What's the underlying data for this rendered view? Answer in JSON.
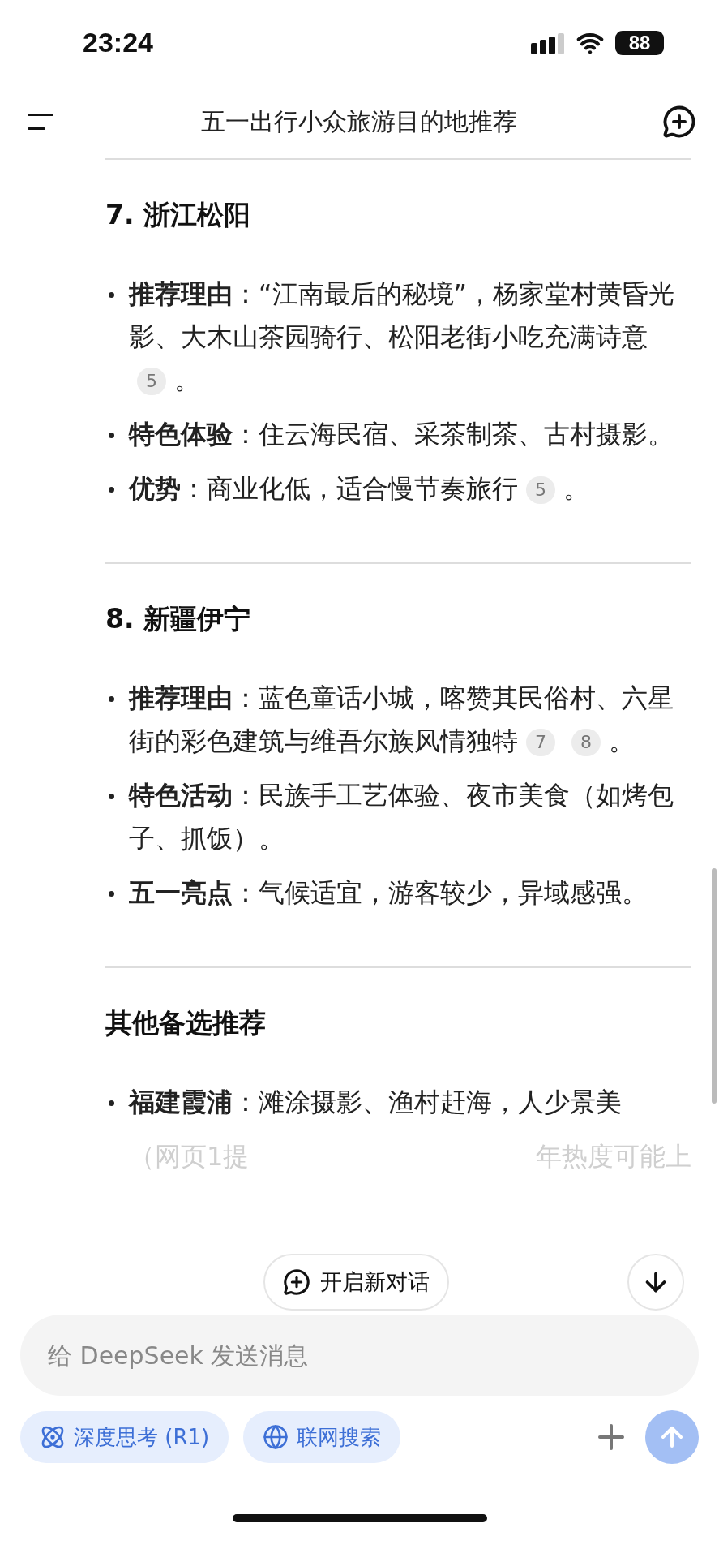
{
  "status_bar": {
    "time": "23:24",
    "battery": "88"
  },
  "header": {
    "title": "五一出行小众旅游目的地推荐"
  },
  "sections": [
    {
      "heading": "7. 浙江松阳",
      "items": [
        {
          "label": "推荐理由",
          "text": "：“江南最后的秘境”，杨家堂村黄昏光影、大木山茶园骑行、松阳老街小吃充满诗意",
          "citations": [
            "5"
          ],
          "end": "。"
        },
        {
          "label": "特色体验",
          "text": "：住云海民宿、采茶制茶、古村摄影。"
        },
        {
          "label": "优势",
          "text": "：商业化低，适合慢节奏旅行",
          "citations": [
            "5"
          ],
          "end": "。"
        }
      ]
    },
    {
      "heading": "8. 新疆伊宁",
      "items": [
        {
          "label": "推荐理由",
          "text": "：蓝色童话小城，喀赞其民俗村、六星街的彩色建筑与维吾尔族风情独特",
          "citations": [
            "7",
            "8"
          ],
          "end": "。"
        },
        {
          "label": "特色活动",
          "text": "：民族手工艺体验、夜市美食（如烤包子、抓饭）。"
        },
        {
          "label": "五一亮点",
          "text": "：气候适宜，游客较少，异域感强。"
        }
      ]
    },
    {
      "heading": "其他备选推荐",
      "items": [
        {
          "label": "福建霞浦",
          "text": "：滩涂摄影、渔村赶海，人少景美",
          "faded": {
            "left": "（网页1提",
            "right": "年热度可能上"
          }
        }
      ]
    }
  ],
  "new_chat_button": "开启新对话",
  "composer": {
    "placeholder": "给 DeepSeek 发送消息",
    "chips": [
      {
        "label": "深度思考 (R1)",
        "selected": false
      },
      {
        "label": "联网搜索",
        "selected": false
      }
    ],
    "send_disabled": true
  }
}
